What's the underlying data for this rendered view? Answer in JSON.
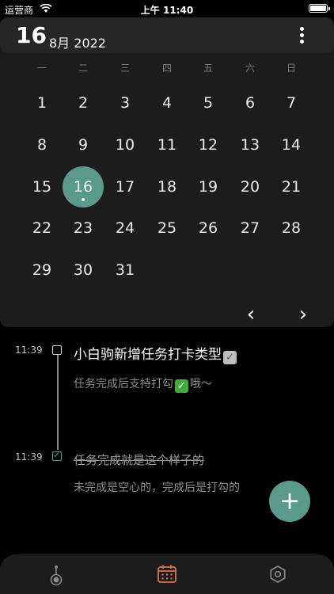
{
  "status_bar": {
    "carrier": "运营商",
    "time": "上午 11:40",
    "icons": [
      "wifi-icon",
      "battery-icon"
    ]
  },
  "calendar": {
    "day": "16",
    "month_year": "8月 2022",
    "weekdays": [
      "一",
      "二",
      "三",
      "四",
      "五",
      "六",
      "日"
    ],
    "dates": [
      "1",
      "2",
      "3",
      "4",
      "5",
      "6",
      "7",
      "8",
      "9",
      "10",
      "11",
      "12",
      "13",
      "14",
      "15",
      "16",
      "17",
      "18",
      "19",
      "20",
      "21",
      "22",
      "23",
      "24",
      "25",
      "26",
      "27",
      "28",
      "29",
      "30",
      "31"
    ],
    "selected_date": "16",
    "prev_label": "‹",
    "next_label": "›",
    "accent_color": "#5a9a8a"
  },
  "tasks": [
    {
      "time": "11:39",
      "title": "小白驹新增任务打卡类型",
      "note_before": "任务完成后支持打勾",
      "note_after": "哦～",
      "done": false
    },
    {
      "time": "11:39",
      "title": "任务完成就是这个样子的",
      "note": "未完成是空心的，完成后是打勾的",
      "done": true
    }
  ],
  "fab": {
    "label": "+"
  },
  "tab_bar": {
    "tabs": [
      {
        "icon": "timeline-icon",
        "active": false
      },
      {
        "icon": "calendar-icon",
        "active": true
      },
      {
        "icon": "settings-icon",
        "active": false
      }
    ],
    "active_color": "#e0733a"
  }
}
